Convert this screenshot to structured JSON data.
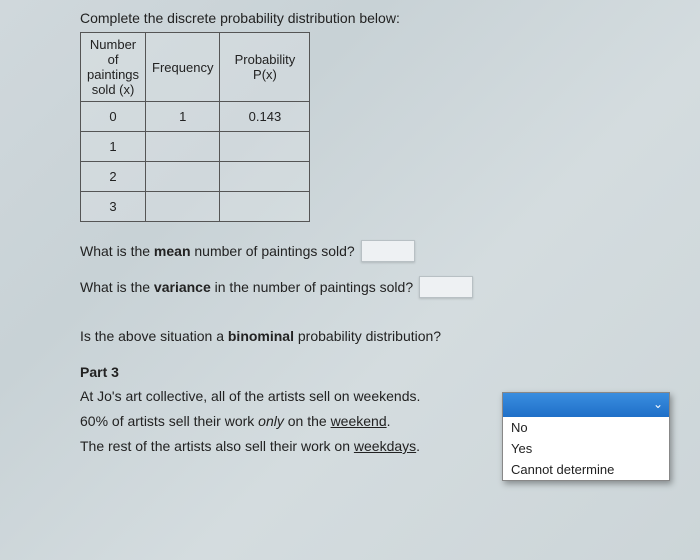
{
  "instruction": "Complete the discrete probability distribution below:",
  "table": {
    "headers": {
      "x": "Number of paintings sold (x)",
      "f": "Frequency",
      "p": "Probability P(x)"
    },
    "rows": [
      {
        "x": "0",
        "f": "1",
        "p": "0.143"
      },
      {
        "x": "1",
        "f": "",
        "p": ""
      },
      {
        "x": "2",
        "f": "",
        "p": ""
      },
      {
        "x": "3",
        "f": "",
        "p": ""
      }
    ]
  },
  "q_mean_pre": "What is the ",
  "q_mean_bold": "mean",
  "q_mean_post": " number of paintings sold?",
  "q_var_pre": "What is the ",
  "q_var_bold": "variance",
  "q_var_post": " in the number of paintings sold?",
  "q_bin_pre": "Is the above situation a ",
  "q_bin_bold": "binominal",
  "q_bin_post": " probability distribution?",
  "part3": {
    "heading": "Part 3",
    "line1_a": "At Jo's art collective, all of the artists sell on weekends.",
    "line2_a": "60% of artists sell their work ",
    "line2_i": "only",
    "line2_b": " on the ",
    "line2_u": "weekend",
    "line2_c": ".",
    "line3_a": "The rest of the artists also sell their work on ",
    "line3_u": "weekdays",
    "line3_b": "."
  },
  "dropdown": {
    "options": [
      "No",
      "Yes",
      "Cannot determine"
    ]
  }
}
